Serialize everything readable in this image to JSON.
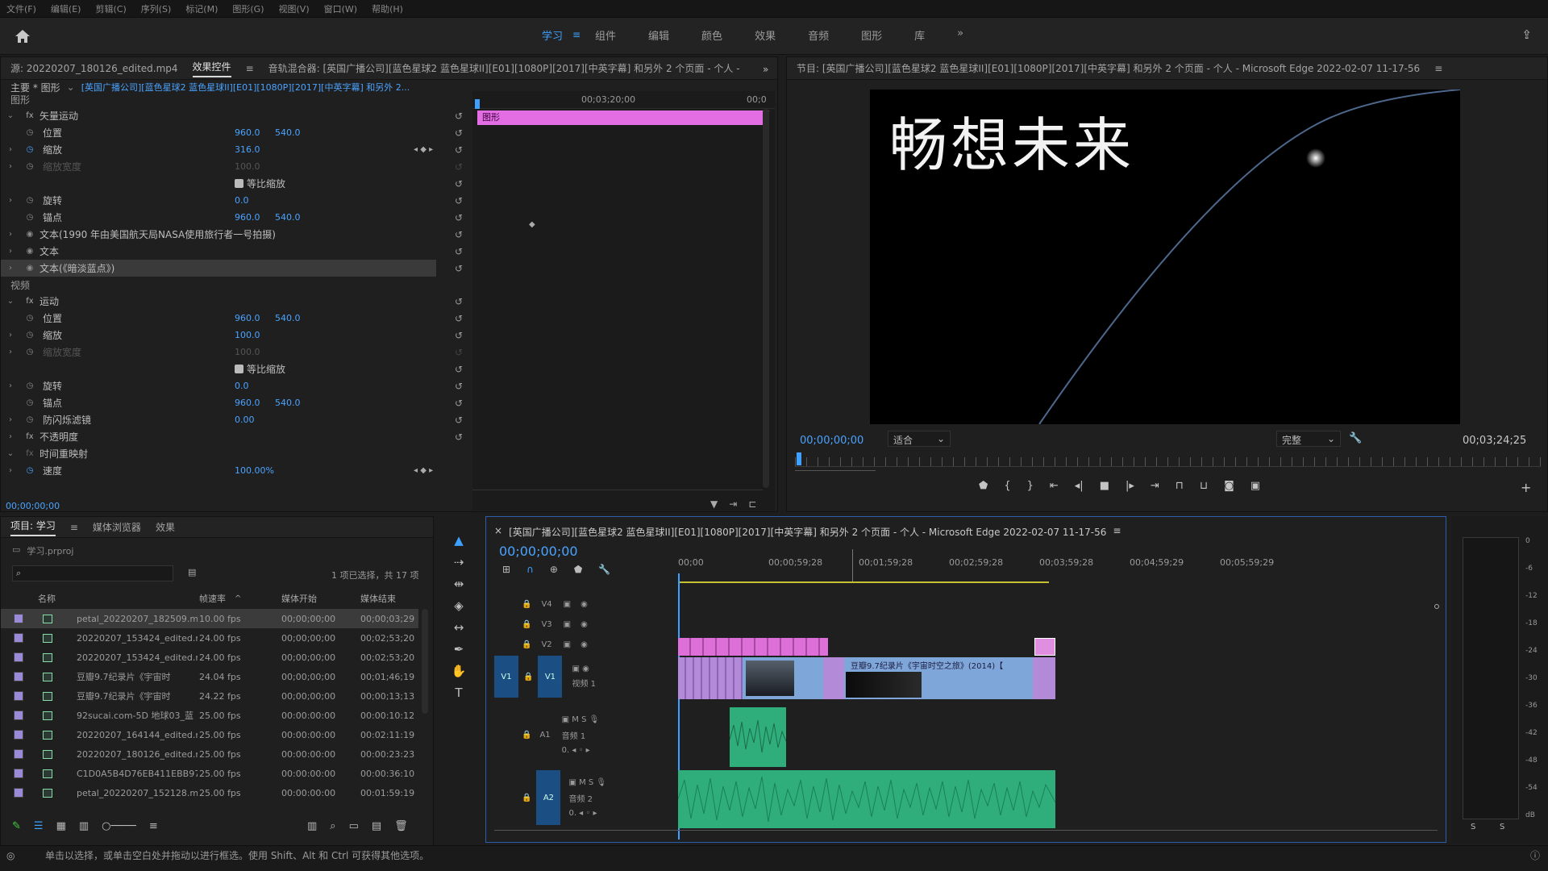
{
  "menu": [
    "文件(F)",
    "编辑(E)",
    "剪辑(C)",
    "序列(S)",
    "标记(M)",
    "图形(G)",
    "视图(V)",
    "窗口(W)",
    "帮助(H)"
  ],
  "workspaces": [
    "学习",
    "组件",
    "编辑",
    "颜色",
    "效果",
    "音频",
    "图形",
    "库"
  ],
  "workspace_active": "学习",
  "effect_panel": {
    "source_tab": "源: 20220207_180126_edited.mp4",
    "effects_tab": "效果控件",
    "mixer_tab": "音轨混合器: [英国广播公司][蓝色星球2 蓝色星球II][E01][1080P][2017][中英字幕] 和另外 2 个页面 - 个人 -",
    "master_label": "主要 * 图形",
    "master_clip": "[英国广播公司][蓝色星球2 蓝色星球II][E01][1080P][2017][中英字幕] 和另外 2...",
    "time_mark": "00;03;20;00",
    "time_end": "00;0",
    "clip_label": "图形",
    "bottom_time": "00;00;00;00",
    "section_graphic": "图形",
    "section_video": "视频",
    "vector_motion": "矢量运动",
    "position": "位置",
    "scale": "缩放",
    "scale_width": "缩放宽度",
    "uniform_scale": "等比缩放",
    "rotation": "旋转",
    "anchor": "锚点",
    "text1": "文本(1990 年由美国航天局NASA使用旅行者一号拍摄)",
    "text2": "文本",
    "text3": "文本(《暗淡蓝点》)",
    "motion": "运动",
    "flicker": "防闪烁滤镜",
    "opacity": "不透明度",
    "time_remap": "时间重映射",
    "speed": "速度",
    "vm_pos_x": "960.0",
    "vm_pos_y": "540.0",
    "vm_scale": "316.0",
    "vm_scale_w": "100.0",
    "vm_rot": "0.0",
    "vm_anchor_x": "960.0",
    "vm_anchor_y": "540.0",
    "m_pos_x": "960.0",
    "m_pos_y": "540.0",
    "m_scale": "100.0",
    "m_scale_w": "100.0",
    "m_rot": "0.0",
    "m_anchor_x": "960.0",
    "m_anchor_y": "540.0",
    "m_flicker": "0.00",
    "speed_val": "100.00%"
  },
  "program": {
    "title": "节目: [英国广播公司][蓝色星球2 蓝色星球II][E01][1080P][2017][中英字幕] 和另外 2 个页面 - 个人 - Microsoft Edge 2022-02-07 11-17-56",
    "overlay_text": "畅想未来",
    "timecode": "00;00;00;00",
    "fit": "适合",
    "quality": "完整",
    "duration": "00;03;24;25"
  },
  "project": {
    "tabs": [
      "项目: 学习",
      "媒体浏览器",
      "效果"
    ],
    "file": "学习.prproj",
    "count": "1 项已选择，共 17 项",
    "search_placeholder": "",
    "columns": [
      "名称",
      "帧速率",
      "媒体开始",
      "媒体结束"
    ],
    "rows": [
      {
        "name": "petal_20220207_182509.m",
        "fps": "10.00 fps",
        "start": "00;00;00;00",
        "end": "00;00;03;29",
        "color": "#9a8ad8",
        "sel": true
      },
      {
        "name": "20220207_153424_edited.m",
        "fps": "24.00 fps",
        "start": "00;00;00;00",
        "end": "00;02;53;20",
        "color": "#9a8ad8"
      },
      {
        "name": "20220207_153424_edited.m",
        "fps": "24.00 fps",
        "start": "00;00;00;00",
        "end": "00;02;53;20",
        "color": "#9a8ad8"
      },
      {
        "name": "豆瓣9.7纪录片《宇宙时",
        "fps": "24.04 fps",
        "start": "00;00;00;00",
        "end": "00;01;46;19",
        "color": "#9a8ad8"
      },
      {
        "name": "豆瓣9.7纪录片《宇宙时",
        "fps": "24.22 fps",
        "start": "00;00;00;00",
        "end": "00;00;13;13",
        "color": "#9a8ad8"
      },
      {
        "name": "92sucai.com-5D 地球03_蓝",
        "fps": "25.00 fps",
        "start": "00:00:00:00",
        "end": "00:00:10:12",
        "color": "#9a8ad8"
      },
      {
        "name": "20220207_164144_edited.m",
        "fps": "25.00 fps",
        "start": "00:00:00:00",
        "end": "00:02:11:19",
        "color": "#9a8ad8"
      },
      {
        "name": "20220207_180126_edited.m",
        "fps": "25.00 fps",
        "start": "00:00:00:00",
        "end": "00:00:23:23",
        "color": "#9a8ad8"
      },
      {
        "name": "C1D0A5B4D76EB411EBB97",
        "fps": "25.00 fps",
        "start": "00:00:00:00",
        "end": "00:00:36:10",
        "color": "#9a8ad8"
      },
      {
        "name": "petal_20220207_152128.m",
        "fps": "25.00 fps",
        "start": "00:00:00:00",
        "end": "00:01:59:19",
        "color": "#9a8ad8"
      }
    ]
  },
  "timeline": {
    "title": "[英国广播公司][蓝色星球2 蓝色星球II][E01][1080P][2017][中英字幕] 和另外 2 个页面 - 个人 - Microsoft Edge 2022-02-07 11-17-56",
    "timecode": "00;00;00;00",
    "ruler": [
      "00;00",
      "00;00;59;28",
      "00;01;59;28",
      "00;02;59;28",
      "00;03;59;28",
      "00;04;59;29",
      "00;05;59;29"
    ],
    "tracks": {
      "v4": "V4",
      "v3": "V3",
      "v2": "V2",
      "v1": "V1",
      "v1_name": "视频 1",
      "a1": "A1",
      "a1_name": "音频 1",
      "a2": "A2",
      "a2_name": "音频 2"
    },
    "clip_label": "豆瓣9.7纪录片《宇宙时空之旅》(2014)【"
  },
  "meter": {
    "scale": [
      "0",
      "-6",
      "-12",
      "-18",
      "-24",
      "-30",
      "-36",
      "-42",
      "-48",
      "-54",
      "dB"
    ],
    "solo": "S"
  },
  "status": "单击以选择，或单击空白处并拖动以进行框选。使用 Shift、Alt 和 Ctrl 可获得其他选项。"
}
